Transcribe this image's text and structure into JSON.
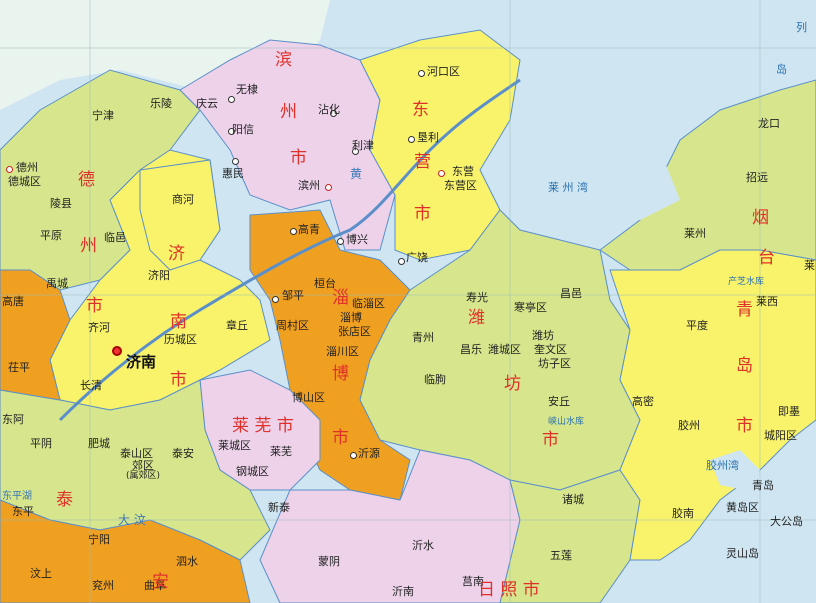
{
  "map": {
    "colors": {
      "sea": "#cfe6f2",
      "yellow": "#f8f36a",
      "green": "#d7e68c",
      "pink": "#edd2ea",
      "orange": "#f0a020",
      "red_text": "#e0302a",
      "border": "#5b8fc9"
    },
    "prefectures": {
      "binzhou": "滨州市",
      "dongying": "东营市",
      "dezhou": "德州市",
      "jinan": "济南市",
      "zibo": "淄博市",
      "weifang": "潍坊市",
      "laiwu": "莱芜市",
      "taian": "泰安市",
      "yantai": "烟台",
      "qingdao": "青岛市",
      "rizhao": "日照市"
    },
    "capital": "济南",
    "labels": {
      "kenli": "垦利",
      "hekou": "河口区",
      "lijin": "利津",
      "dongying_c": "东营",
      "dongying_d": "东营区",
      "guangrao": "广饶",
      "wudi": "无棣",
      "yangxin": "阳信",
      "zhanhua": "沾化",
      "huimin": "惠民",
      "binzhou_c": "滨州",
      "boxing": "博兴",
      "gaoqing": "高青",
      "zouping": "邹平",
      "huantai": "桓台",
      "linzi": "临淄区",
      "zibo_c": "淄博",
      "zhangdian": "张店区",
      "zhoucun": "周村区",
      "zichuan": "淄川区",
      "boshan": "博山区",
      "yiyuan": "沂源",
      "ningjin": "宁津",
      "leling": "乐陵",
      "qingyun": "庆云",
      "dezhou_c": "德州",
      "decheng": "德城区",
      "lingxian": "陵县",
      "pingyuan": "平原",
      "linyi": "临邑",
      "shanghe": "商河",
      "jiyang": "济阳",
      "yucheng": "禹城",
      "qihe": "齐河",
      "licheng": "历城区",
      "zhangqiu": "章丘",
      "changqing": "长清",
      "gaotang": "高唐",
      "chiping": "茌平",
      "donge": "东阿",
      "pingyin": "平阴",
      "feicheng": "肥城",
      "taishan": "泰山区",
      "jiaoqu": "郊区",
      "shuangying": "(属郊区)",
      "taian_c": "泰安",
      "laicheng": "莱城区",
      "laiwu_c": "莱芜",
      "gangcheng": "钢城区",
      "xintai": "新泰",
      "dongping": "东平",
      "ningyang": "宁阳",
      "sishui": "泗水",
      "qufu": "曲阜",
      "wenshang": "汶上",
      "yanzhou": "兖州",
      "mengyin": "蒙阴",
      "yishui": "沂水",
      "yinan": "沂南",
      "junan": "莒南",
      "wulian": "五莲",
      "zhucheng": "诸城",
      "anqiu": "安丘",
      "linqu": "临朐",
      "qingzhou": "青州",
      "shouguang": "寿光",
      "changle": "昌乐",
      "weicheng": "潍城区",
      "hanting": "寒亭区",
      "weifang_c": "潍坊",
      "kuiwen": "奎文区",
      "fangzi": "坊子区",
      "changyi": "昌邑",
      "gaomi": "高密",
      "pingdu": "平度",
      "laixi": "莱西",
      "jimo": "即墨",
      "jiaozhou": "胶州",
      "chengyang": "城阳区",
      "qingdao_c": "青岛",
      "jiaonan": "胶南",
      "huangdao": "黄岛区",
      "dagongdao": "大公岛",
      "lingshandao": "灵山岛",
      "longkou": "龙口",
      "zhaoyuan": "招远",
      "laizhou": "莱州",
      "lai_edge": "莱",
      "laizhouwan": "莱 州 湾",
      "jiaozhouwan": "胶州湾",
      "chanzhishui": "产芝水库",
      "xiashan": "峡山水库",
      "liedao": "列",
      "dao": "岛",
      "dawenhe": "大 汶",
      "dongpinghu": "东平湖",
      "huanghe": "黄"
    }
  }
}
